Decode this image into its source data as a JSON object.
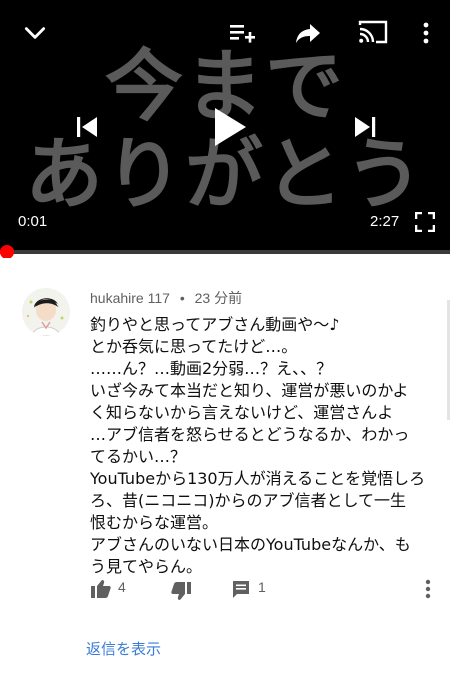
{
  "player": {
    "overlay_line1": "今まで",
    "overlay_line2": "ありがとう",
    "current_time": "0:01",
    "duration": "2:27",
    "progress_fraction": 0.007
  },
  "comment": {
    "author": "hukahire 117",
    "separator": "•",
    "time_ago": "23 分前",
    "lines": [
      "釣りやと思ってアブさん動画や〜♪",
      "とか呑気に思ってたけど…。",
      "……ん？…動画2分弱…？え、、？",
      "いざ今みて本当だと知り、運営が悪いのかよ",
      "く知らないから言えないけど、運営さんよ",
      "…アブ信者を怒らせるとどうなるか、わかっ",
      "てるかい…？",
      "YouTubeから130万人が消えることを覚悟しろ",
      "ろ、昔(ニコニコ)からのアブ信者として一生",
      "恨むからな運営。",
      "アブさんのいない日本のYouTubeなんか、も",
      "う見てやらん。"
    ],
    "likes": "4",
    "reply_count": "1",
    "view_replies": "返信を表示"
  },
  "icons": {
    "collapse": "chevron-down-icon",
    "add_to_queue": "playlist-add-icon",
    "share": "share-icon",
    "cast": "cast-icon",
    "more": "more-vert-icon",
    "previous": "skip-previous-icon",
    "play": "play-icon",
    "next": "skip-next-icon",
    "fullscreen": "fullscreen-icon",
    "like": "thumb-up-icon",
    "dislike": "thumb-down-icon",
    "reply": "comment-icon"
  },
  "colors": {
    "accent_red": "#ff0000",
    "link_blue": "#3a7cd6"
  }
}
